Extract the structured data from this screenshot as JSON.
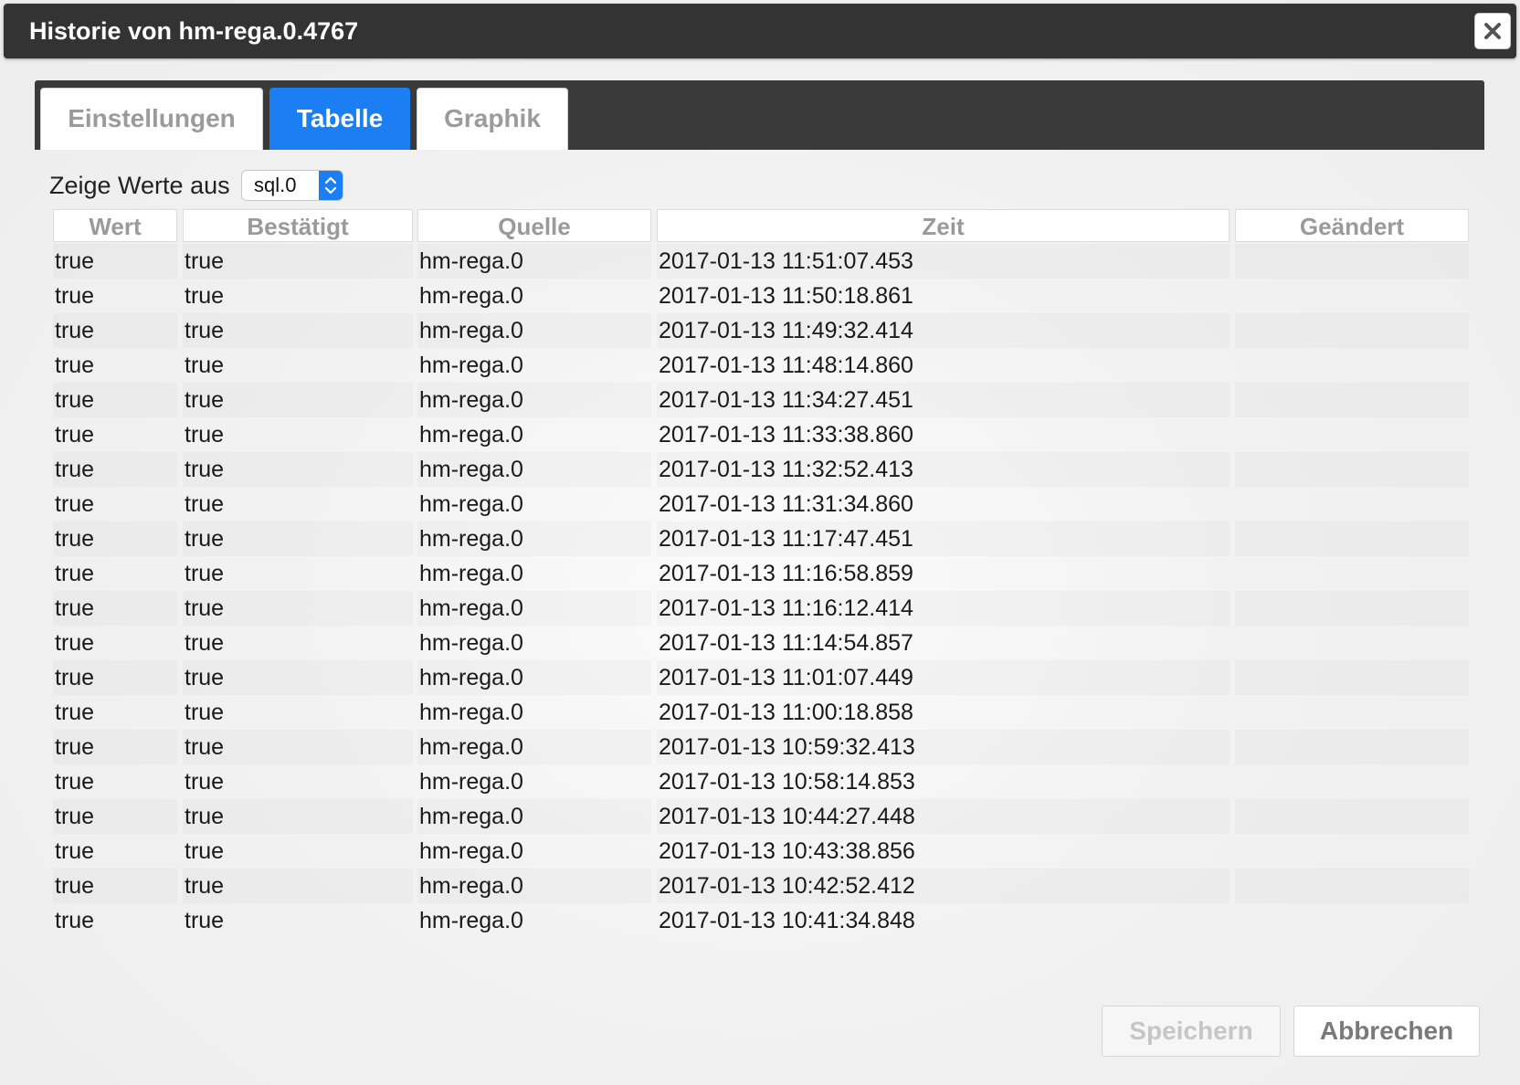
{
  "dialog": {
    "title": "Historie von hm-rega.0.4767",
    "close_icon": "close-icon"
  },
  "tabs": [
    {
      "label": "Einstellungen",
      "active": false
    },
    {
      "label": "Tabelle",
      "active": true
    },
    {
      "label": "Graphik",
      "active": false
    }
  ],
  "source": {
    "label": "Zeige Werte aus",
    "selected": "sql.0"
  },
  "table": {
    "columns": [
      "Wert",
      "Bestätigt",
      "Quelle",
      "Zeit",
      "Geändert"
    ],
    "rows": [
      {
        "wert": "true",
        "bestaetigt": "true",
        "quelle": "hm-rega.0",
        "zeit": "2017-01-13 11:51:07.453",
        "geaendert": ""
      },
      {
        "wert": "true",
        "bestaetigt": "true",
        "quelle": "hm-rega.0",
        "zeit": "2017-01-13 11:50:18.861",
        "geaendert": ""
      },
      {
        "wert": "true",
        "bestaetigt": "true",
        "quelle": "hm-rega.0",
        "zeit": "2017-01-13 11:49:32.414",
        "geaendert": ""
      },
      {
        "wert": "true",
        "bestaetigt": "true",
        "quelle": "hm-rega.0",
        "zeit": "2017-01-13 11:48:14.860",
        "geaendert": ""
      },
      {
        "wert": "true",
        "bestaetigt": "true",
        "quelle": "hm-rega.0",
        "zeit": "2017-01-13 11:34:27.451",
        "geaendert": ""
      },
      {
        "wert": "true",
        "bestaetigt": "true",
        "quelle": "hm-rega.0",
        "zeit": "2017-01-13 11:33:38.860",
        "geaendert": ""
      },
      {
        "wert": "true",
        "bestaetigt": "true",
        "quelle": "hm-rega.0",
        "zeit": "2017-01-13 11:32:52.413",
        "geaendert": ""
      },
      {
        "wert": "true",
        "bestaetigt": "true",
        "quelle": "hm-rega.0",
        "zeit": "2017-01-13 11:31:34.860",
        "geaendert": ""
      },
      {
        "wert": "true",
        "bestaetigt": "true",
        "quelle": "hm-rega.0",
        "zeit": "2017-01-13 11:17:47.451",
        "geaendert": ""
      },
      {
        "wert": "true",
        "bestaetigt": "true",
        "quelle": "hm-rega.0",
        "zeit": "2017-01-13 11:16:58.859",
        "geaendert": ""
      },
      {
        "wert": "true",
        "bestaetigt": "true",
        "quelle": "hm-rega.0",
        "zeit": "2017-01-13 11:16:12.414",
        "geaendert": ""
      },
      {
        "wert": "true",
        "bestaetigt": "true",
        "quelle": "hm-rega.0",
        "zeit": "2017-01-13 11:14:54.857",
        "geaendert": ""
      },
      {
        "wert": "true",
        "bestaetigt": "true",
        "quelle": "hm-rega.0",
        "zeit": "2017-01-13 11:01:07.449",
        "geaendert": ""
      },
      {
        "wert": "true",
        "bestaetigt": "true",
        "quelle": "hm-rega.0",
        "zeit": "2017-01-13 11:00:18.858",
        "geaendert": ""
      },
      {
        "wert": "true",
        "bestaetigt": "true",
        "quelle": "hm-rega.0",
        "zeit": "2017-01-13 10:59:32.413",
        "geaendert": ""
      },
      {
        "wert": "true",
        "bestaetigt": "true",
        "quelle": "hm-rega.0",
        "zeit": "2017-01-13 10:58:14.853",
        "geaendert": ""
      },
      {
        "wert": "true",
        "bestaetigt": "true",
        "quelle": "hm-rega.0",
        "zeit": "2017-01-13 10:44:27.448",
        "geaendert": ""
      },
      {
        "wert": "true",
        "bestaetigt": "true",
        "quelle": "hm-rega.0",
        "zeit": "2017-01-13 10:43:38.856",
        "geaendert": ""
      },
      {
        "wert": "true",
        "bestaetigt": "true",
        "quelle": "hm-rega.0",
        "zeit": "2017-01-13 10:42:52.412",
        "geaendert": ""
      },
      {
        "wert": "true",
        "bestaetigt": "true",
        "quelle": "hm-rega.0",
        "zeit": "2017-01-13 10:41:34.848",
        "geaendert": ""
      }
    ]
  },
  "footer": {
    "save_label": "Speichern",
    "cancel_label": "Abbrechen"
  },
  "colors": {
    "accent": "#1b7ff3",
    "titlebar": "#333333",
    "tabbar": "#3a3a3a"
  }
}
